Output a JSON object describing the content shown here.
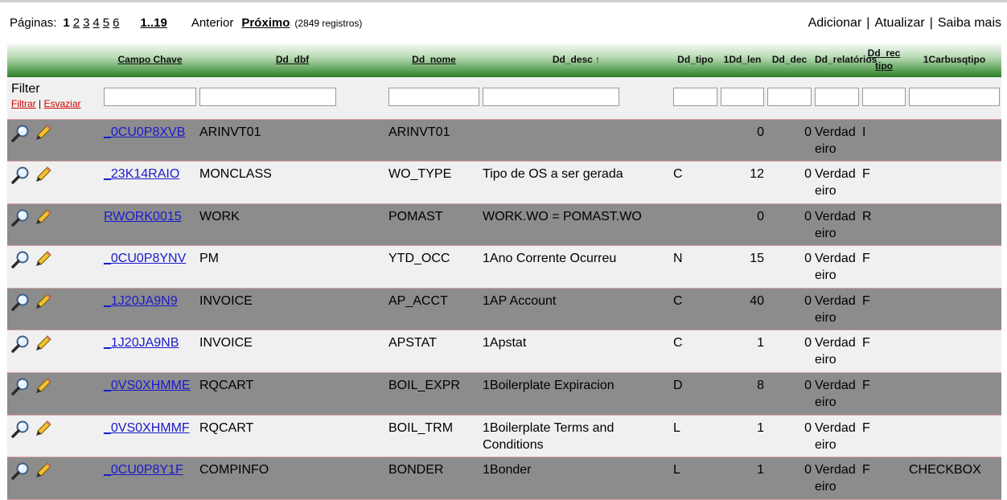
{
  "pager": {
    "label": "Páginas:",
    "pages": [
      "1",
      "2",
      "3",
      "4",
      "5",
      "6"
    ],
    "current": "1",
    "range": "1..19",
    "prev": "Anterior",
    "next": "Próximo",
    "count": "(2849 registros)"
  },
  "actions": {
    "add": "Adicionar",
    "refresh": "Atualizar",
    "more": "Saiba mais",
    "separator": "|"
  },
  "table": {
    "headers": [
      {
        "label": "",
        "link": false
      },
      {
        "label": "Campo Chave",
        "link": true
      },
      {
        "label": "Dd_dbf",
        "link": true
      },
      {
        "label": "Dd_nome",
        "link": true
      },
      {
        "label": "Dd_desc ↑",
        "link": false
      },
      {
        "label": "Dd_tipo",
        "link": false
      },
      {
        "label": "1Dd_len",
        "link": false
      },
      {
        "label": "Dd_dec",
        "link": false
      },
      {
        "label": "Dd_relatórios",
        "link": false
      },
      {
        "label": "Dd_rec tipo",
        "link": true
      },
      {
        "label": "1Carbusqtipo",
        "link": false
      }
    ],
    "filter": {
      "label": "Filter",
      "apply": "Filtrar",
      "separator": "|",
      "clear": "Esvaziar"
    },
    "rows": [
      {
        "key": "_0CU0P8XVB",
        "dbf": "ARINVT01",
        "nome": "ARINVT01",
        "desc": "",
        "tipo": "",
        "len": "0",
        "dec": "0",
        "rel": "Verdadeiro",
        "rec": "I",
        "carb": ""
      },
      {
        "key": "_23K14RAIO",
        "dbf": "MONCLASS",
        "nome": "WO_TYPE",
        "desc": " Tipo de OS a ser gerada",
        "tipo": "C",
        "len": "12",
        "dec": "0",
        "rel": "Verdadeiro",
        "rec": "F",
        "carb": ""
      },
      {
        "key": "RWORK0015",
        "dbf": "WORK",
        "nome": "POMAST",
        "desc": " WORK.WO = POMAST.WO",
        "tipo": "",
        "len": "0",
        "dec": "0",
        "rel": "Verdadeiro",
        "rec": "R",
        "carb": ""
      },
      {
        "key": "_0CU0P8YNV",
        "dbf": "PM",
        "nome": "YTD_OCC",
        "desc": "1Ano Corrente Ocurreu",
        "tipo": "N",
        "len": "15",
        "dec": "0",
        "rel": "Verdadeiro",
        "rec": "F",
        "carb": ""
      },
      {
        "key": "_1J20JA9N9",
        "dbf": "INVOICE",
        "nome": "AP_ACCT",
        "desc": "1AP Account",
        "tipo": "C",
        "len": "40",
        "dec": "0",
        "rel": "Verdadeiro",
        "rec": "F",
        "carb": ""
      },
      {
        "key": "_1J20JA9NB",
        "dbf": "INVOICE",
        "nome": "APSTAT",
        "desc": "1Apstat",
        "tipo": "C",
        "len": "1",
        "dec": "0",
        "rel": "Verdadeiro",
        "rec": "F",
        "carb": ""
      },
      {
        "key": "_0VS0XHMME",
        "dbf": "RQCART",
        "nome": "BOIL_EXPR",
        "desc": "1Boilerplate Expiracion",
        "tipo": "D",
        "len": "8",
        "dec": "0",
        "rel": "Verdadeiro",
        "rec": "F",
        "carb": ""
      },
      {
        "key": "_0VS0XHMMF",
        "dbf": "RQCART",
        "nome": "BOIL_TRM",
        "desc": "1Boilerplate Terms and Conditions",
        "tipo": "L",
        "len": "1",
        "dec": "0",
        "rel": "Verdadeiro",
        "rec": "F",
        "carb": ""
      },
      {
        "key": "_0CU0P8Y1F",
        "dbf": "COMPINFO",
        "nome": "BONDER",
        "desc": "1Bonder",
        "tipo": "L",
        "len": "1",
        "dec": "0",
        "rel": "Verdadeiro",
        "rec": "F",
        "carb": "CHECKBOX"
      }
    ]
  }
}
